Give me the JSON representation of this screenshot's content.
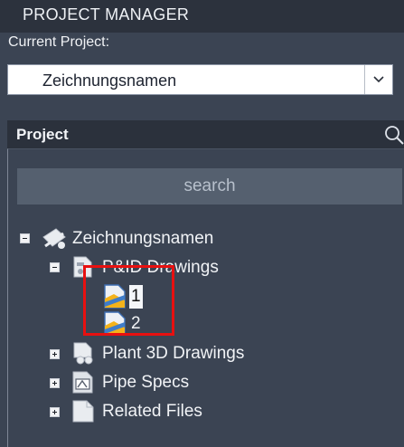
{
  "window": {
    "title": "PROJECT MANAGER"
  },
  "current_project": {
    "label": "Current Project:",
    "value": "Zeichnungsnamen"
  },
  "project_panel": {
    "header": "Project",
    "search_placeholder": "search"
  },
  "tree": {
    "root": "Zeichnungsnamen",
    "pid_drawings": "P&ID Drawings",
    "drawing_1": "1",
    "drawing_2": "2",
    "plant3d_drawings": "Plant 3D Drawings",
    "pipe_specs": "Pipe Specs",
    "related_files": "Related Files"
  },
  "colors": {
    "highlight": "#e81010",
    "background": "#3b4453"
  },
  "icons": {
    "root": "project-icon",
    "pid": "pid-folder-icon",
    "drawing": "pid-drawing-icon",
    "plant3d": "plant3d-folder-icon",
    "specs": "pipe-spec-icon",
    "related": "related-files-icon",
    "search": "magnifier-icon",
    "dropdown": "chevron-down-icon"
  }
}
